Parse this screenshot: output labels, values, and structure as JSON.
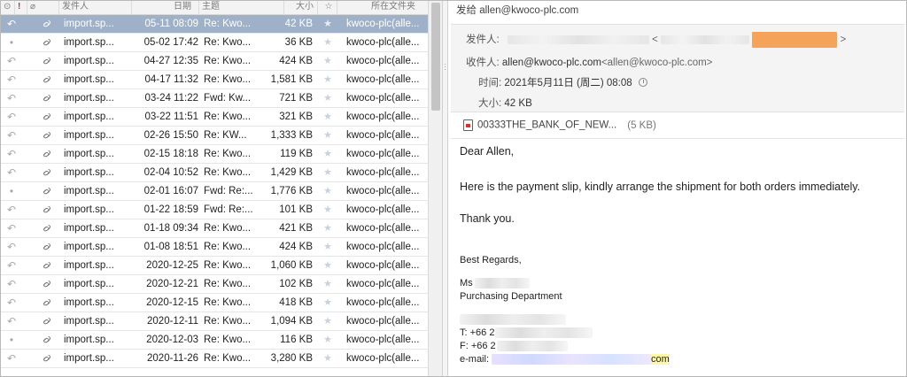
{
  "list": {
    "columns": {
      "flag": "!",
      "from": "发件人",
      "date": "日期",
      "subject": "主题",
      "size": "大小",
      "folder": "所在文件夹"
    },
    "rows": [
      {
        "status": "↶",
        "from": "import.sp...",
        "date": "05-11 08:09",
        "subject": "Re: Kwo...",
        "size": "42 KB",
        "folder": "kwoco-plc(alle..."
      },
      {
        "status": "•",
        "from": "import.sp...",
        "date": "05-02 17:42",
        "subject": "Re: Kwo...",
        "size": "36 KB",
        "folder": "kwoco-plc(alle..."
      },
      {
        "status": "↶",
        "from": "import.sp...",
        "date": "04-27 12:35",
        "subject": "Re: Kwo...",
        "size": "424 KB",
        "folder": "kwoco-plc(alle..."
      },
      {
        "status": "↶",
        "from": "import.sp...",
        "date": "04-17 11:32",
        "subject": "Re: Kwo...",
        "size": "1,581 KB",
        "folder": "kwoco-plc(alle..."
      },
      {
        "status": "↶",
        "from": "import.sp...",
        "date": "03-24 11:22",
        "subject": "Fwd: Kw...",
        "size": "721 KB",
        "folder": "kwoco-plc(alle..."
      },
      {
        "status": "↶",
        "from": "import.sp...",
        "date": "03-22 11:51",
        "subject": "Re: Kwo...",
        "size": "321 KB",
        "folder": "kwoco-plc(alle..."
      },
      {
        "status": "↶",
        "from": "import.sp...",
        "date": "02-26 15:50",
        "subject": "Re: KW...",
        "size": "1,333 KB",
        "folder": "kwoco-plc(alle..."
      },
      {
        "status": "↶",
        "from": "import.sp...",
        "date": "02-15 18:18",
        "subject": "Re: Kwo...",
        "size": "119 KB",
        "folder": "kwoco-plc(alle..."
      },
      {
        "status": "↶",
        "from": "import.sp...",
        "date": "02-04 10:52",
        "subject": "Re: Kwo...",
        "size": "1,429 KB",
        "folder": "kwoco-plc(alle..."
      },
      {
        "status": "•",
        "from": "import.sp...",
        "date": "02-01 16:07",
        "subject": "Fwd: Re:...",
        "size": "1,776 KB",
        "folder": "kwoco-plc(alle..."
      },
      {
        "status": "↶",
        "from": "import.sp...",
        "date": "01-22 18:59",
        "subject": "Fwd: Re:...",
        "size": "101 KB",
        "folder": "kwoco-plc(alle..."
      },
      {
        "status": "↶",
        "from": "import.sp...",
        "date": "01-18 09:34",
        "subject": "Re: Kwo...",
        "size": "421 KB",
        "folder": "kwoco-plc(alle..."
      },
      {
        "status": "↶",
        "from": "import.sp...",
        "date": "01-08 18:51",
        "subject": "Re: Kwo...",
        "size": "424 KB",
        "folder": "kwoco-plc(alle..."
      },
      {
        "status": "↶",
        "from": "import.sp...",
        "date": "2020-12-25",
        "subject": "Re: Kwo...",
        "size": "1,060 KB",
        "folder": "kwoco-plc(alle..."
      },
      {
        "status": "↶",
        "from": "import.sp...",
        "date": "2020-12-21",
        "subject": "Re: Kwo...",
        "size": "102 KB",
        "folder": "kwoco-plc(alle..."
      },
      {
        "status": "↶",
        "from": "import.sp...",
        "date": "2020-12-15",
        "subject": "Re: Kwo...",
        "size": "418 KB",
        "folder": "kwoco-plc(alle..."
      },
      {
        "status": "↶",
        "from": "import.sp...",
        "date": "2020-12-11",
        "subject": "Re: Kwo...",
        "size": "1,094 KB",
        "folder": "kwoco-plc(alle..."
      },
      {
        "status": "•",
        "from": "import.sp...",
        "date": "2020-12-03",
        "subject": "Re: Kwo...",
        "size": "116 KB",
        "folder": "kwoco-plc(alle..."
      },
      {
        "status": "↶",
        "from": "import.sp...",
        "date": "2020-11-26",
        "subject": "Re: Kwo...",
        "size": "3,280 KB",
        "folder": "kwoco-plc(alle..."
      }
    ],
    "selected_index": 0,
    "clip_icon": "paperclip-icon",
    "star_icon": "star-icon"
  },
  "mail": {
    "send_to": "发给 allen@kwoco-plc.com",
    "from_label": "发件人:",
    "to_label": "收件人:",
    "to_value": "allen@kwoco-plc.com",
    "to_addr": "<allen@kwoco-plc.com>",
    "time_label": "时间:",
    "time_value": "2021年5月11日 (周二) 08:08",
    "size_label": "大小:",
    "size_value": "42 KB",
    "attachment_name": "00333THE_BANK_OF_NEW...",
    "attachment_size": "(5 KB)",
    "body": {
      "greeting": "Dear Allen,",
      "line1": "Here is the payment slip, kindly arrange the shipment for both orders immediately.",
      "thanks": "Thank you.",
      "regards": "Best Regards,",
      "name_prefix": "Ms",
      "department": "Purchasing Department",
      "tel_label": "T: +66 2",
      "fax_label": "F: +66 2",
      "email_label": "e-mail:",
      "email_suffix": "com"
    }
  },
  "colors": {
    "selected_row": "#9fb1c8",
    "redaction_orange": "#f5a25a",
    "highlight_yellow": "#fff7a8"
  }
}
